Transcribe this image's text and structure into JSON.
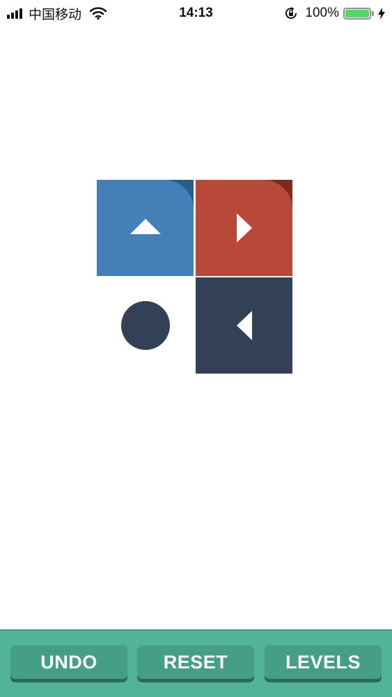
{
  "status_bar": {
    "carrier": "中国移动",
    "time": "14:13",
    "battery_percent": "100%",
    "battery_level": 1.0,
    "icons": [
      "signal-bars-icon",
      "wifi-icon",
      "orientation-lock-icon",
      "battery-icon",
      "charging-bolt-icon"
    ]
  },
  "board": {
    "tiles": [
      {
        "row": 0,
        "col": 0,
        "color": "#4480b7",
        "fold_color": "#2c5b86",
        "direction": "up"
      },
      {
        "row": 0,
        "col": 1,
        "color": "#b84838",
        "fold_color": "#7e2a20",
        "direction": "right"
      },
      {
        "row": 1,
        "col": 1,
        "color": "#324155",
        "fold_color": null,
        "direction": "left"
      }
    ],
    "targets": [
      {
        "row": 1,
        "col": 0,
        "color": "#324155"
      }
    ],
    "arrow_color": "#ffffff"
  },
  "toolbar": {
    "background": "#52b496",
    "button_color": "#449f84",
    "undo_label": "UNDO",
    "reset_label": "RESET",
    "levels_label": "LEVELS"
  }
}
